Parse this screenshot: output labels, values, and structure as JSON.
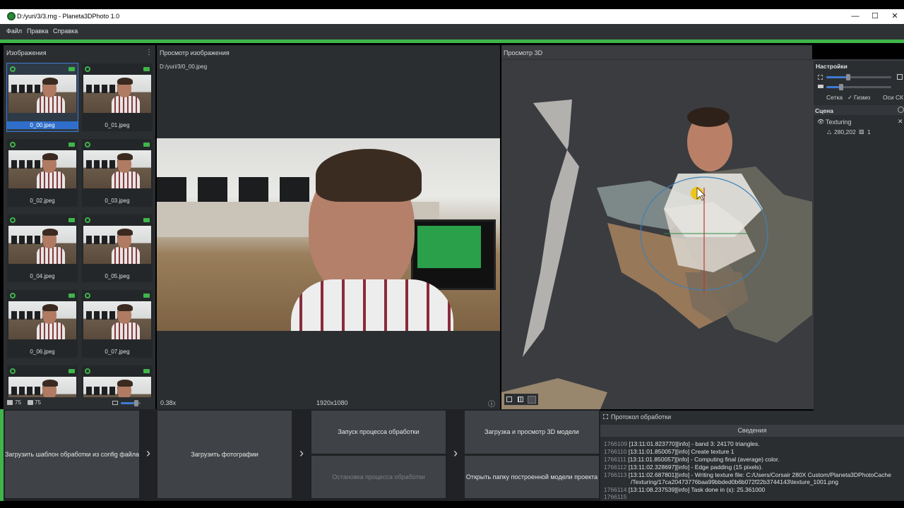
{
  "window": {
    "title": "D:/yuri/3/3.rng - Planeta3DPhoto 1.0",
    "minimize": "—",
    "maximize": "☐",
    "close": "✕"
  },
  "menu": [
    "Файл",
    "Правка",
    "Справка"
  ],
  "images_panel": {
    "title": "Изображения",
    "more": "⋮",
    "thumbs": [
      "0_00.jpeg",
      "0_01.jpeg",
      "0_02.jpeg",
      "0_03.jpeg",
      "0_04.jpeg",
      "0_05.jpeg",
      "0_06.jpeg",
      "0_07.jpeg"
    ],
    "count_images": "75",
    "count_cameras": "75"
  },
  "preview_panel": {
    "title": "Просмотр изображения",
    "path": "D:/yuri/3/0_00.jpeg",
    "zoom": "0.38x",
    "resolution": "1920x1080",
    "info_icon": "ⓘ"
  },
  "view3d_panel": {
    "title": "Просмотр 3D"
  },
  "settings": {
    "title": "Настройки",
    "grid_label": "Сетка",
    "gizmo_check": "✓",
    "gizmo_label": "Гизмо",
    "axes_label": "Оси СК",
    "scene_title": "Сцена",
    "scene_item": "Texturing",
    "scene_triangles": "280,202",
    "scene_textures": "1",
    "remove": "✕"
  },
  "buttons": {
    "load_template": "Загрузить шаблон обработки из config файла",
    "load_photos": "Загрузить фотографии",
    "start": "Запуск процесса обработки",
    "stop": "Остановка процесса обработки",
    "load_view": "Загрузка и просмотр 3D модели",
    "open_folder": "Открыть папку построенной модели проекта",
    "arrow": "›"
  },
  "log": {
    "title": "Протокол обработки",
    "tab": "Сведения",
    "lines": [
      {
        "num": "1766109",
        "text": "[13:11:01.823770][info]        - band 3: 24170 triangles."
      },
      {
        "num": "1766110",
        "text": "[13:11:01.850057][info] Create texture 1"
      },
      {
        "num": "1766111",
        "text": "[13:11:01.850057][info]    - Computing final (average) color."
      },
      {
        "num": "1766112",
        "text": "[13:11:02.328697][info]    - Edge padding (15 pixels)."
      },
      {
        "num": "1766113",
        "text": "[13:11:02.687801][info]    - Writing texture file: C:/Users/Corsair 280X Custom/Planeta3DPhotoCache"
      },
      {
        "num": "",
        "text": "/Texturing/17ca20473776baa99bbded0b6b072f22b3744143\\texture_1001.png"
      },
      {
        "num": "1766114",
        "text": "[13:11:08.237539][info] Task done in (s): 25.361000"
      },
      {
        "num": "1766115",
        "text": ""
      }
    ]
  }
}
